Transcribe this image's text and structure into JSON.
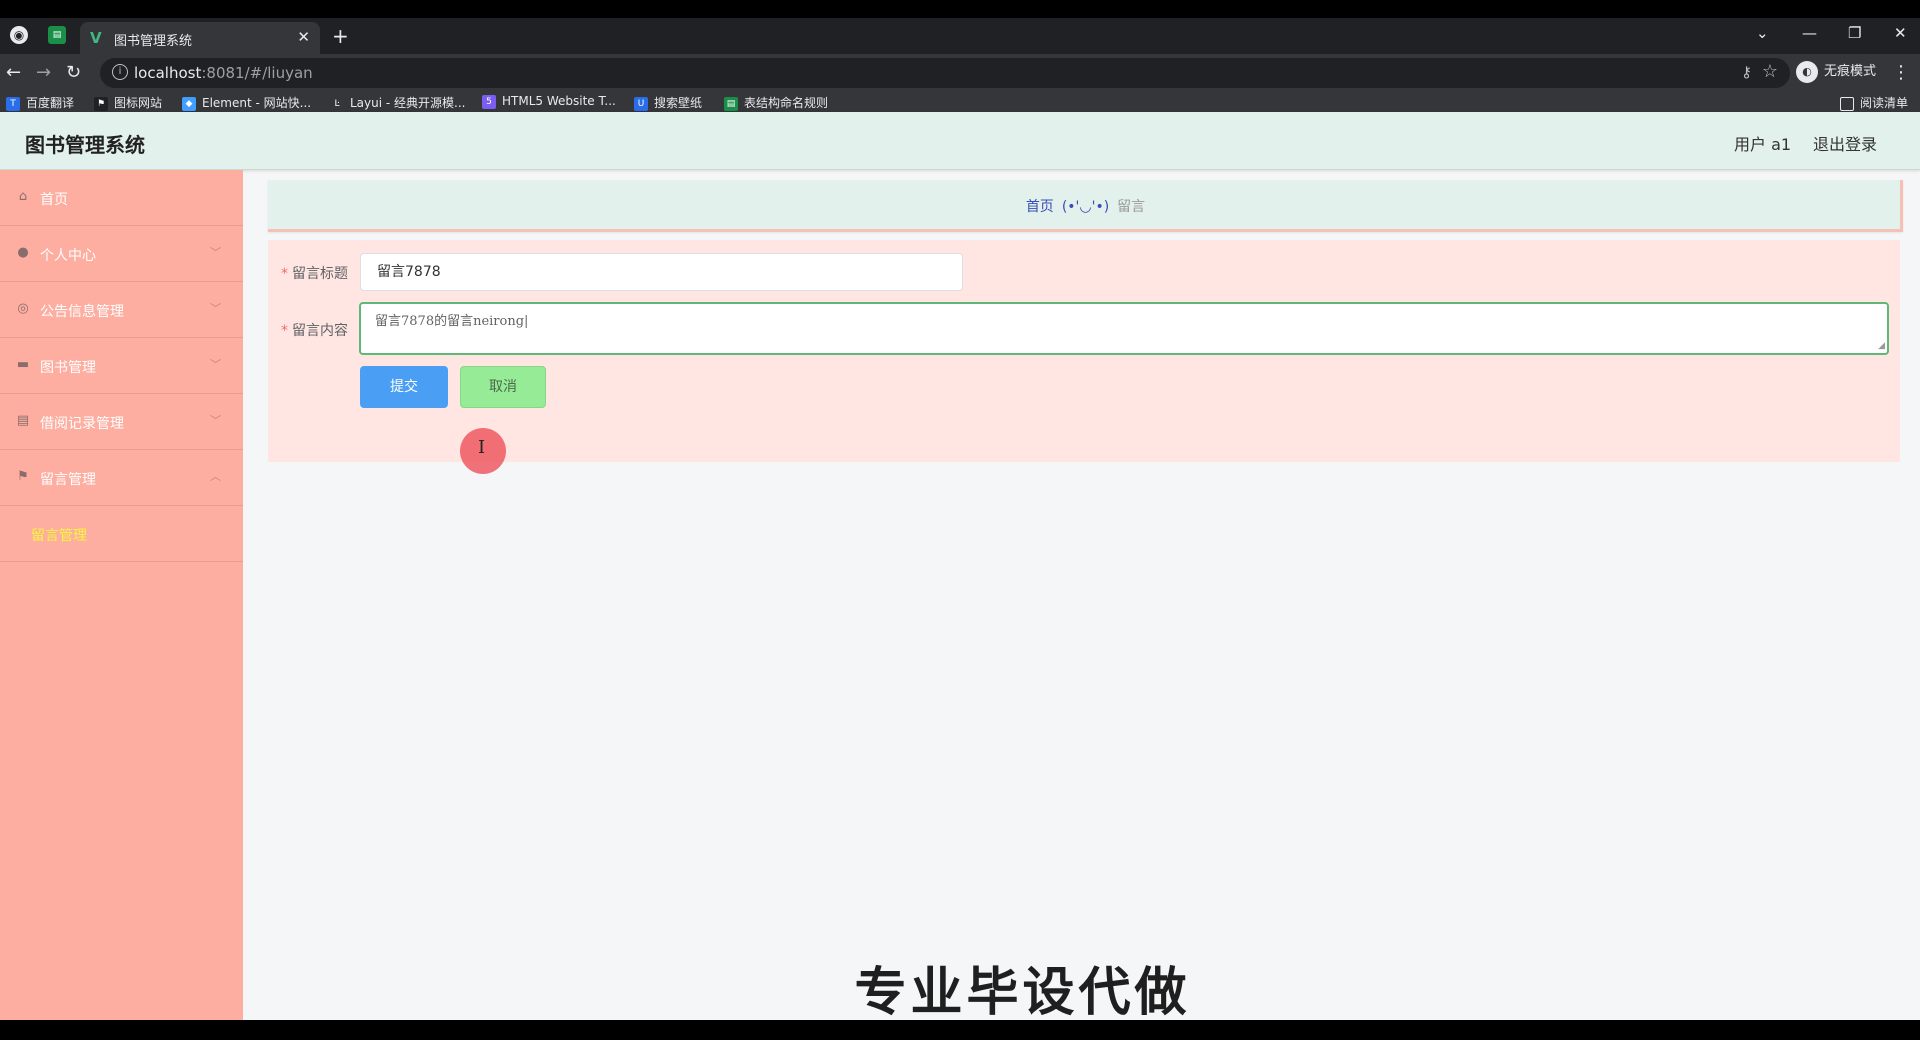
{
  "browser": {
    "tab_title": "图书管理系统",
    "new_tab_label": "+",
    "url_host": "localhost",
    "url_path": ":8081/#/liuyan",
    "incognito_label": "无痕模式",
    "reading_list_label": "阅读清单",
    "bookmarks": [
      {
        "label": "百度翻译",
        "icon": "translate-icon",
        "color": "#2a6de8"
      },
      {
        "label": "图标网站",
        "icon": "flag-icon",
        "color": "#202124"
      },
      {
        "label": "Element - 网站快...",
        "icon": "element-icon",
        "color": "#409eff"
      },
      {
        "label": "Layui - 经典开源模...",
        "icon": "layui-icon",
        "color": "#35363a"
      },
      {
        "label": "HTML5 Website T...",
        "icon": "html5-icon",
        "color": "#7b5ef0"
      },
      {
        "label": "搜索壁纸",
        "icon": "wallpaper-icon",
        "color": "#2a6de8"
      },
      {
        "label": "表结构命名规则",
        "icon": "sheet-icon",
        "color": "#1a8f4a"
      }
    ]
  },
  "header": {
    "title": "图书管理系统",
    "user_label": "用户 a1",
    "logout_label": "退出登录"
  },
  "sidebar": {
    "items": [
      {
        "label": "首页",
        "icon": "home-icon"
      },
      {
        "label": "个人中心",
        "icon": "user-icon"
      },
      {
        "label": "公告信息管理",
        "icon": "notice-icon"
      },
      {
        "label": "图书管理",
        "icon": "book-icon"
      },
      {
        "label": "借阅记录管理",
        "icon": "record-icon"
      },
      {
        "label": "留言管理",
        "icon": "flag-icon"
      }
    ],
    "sub_item": "留言管理"
  },
  "breadcrumb": {
    "home": "首页",
    "separator": "(•'◡'•)",
    "current": "留言"
  },
  "form": {
    "title_label": "留言标题",
    "title_value": "留言7878",
    "content_label": "留言内容",
    "content_value": "留言7878的留言neirong|",
    "submit_label": "提交",
    "cancel_label": "取消"
  },
  "overlay_caption": "专业毕设代做"
}
